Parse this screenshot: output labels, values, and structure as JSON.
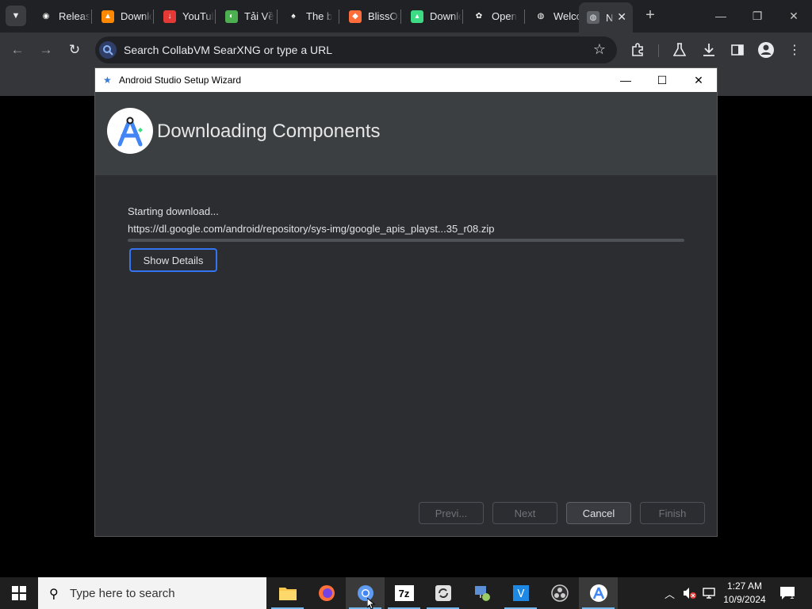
{
  "browser": {
    "tabs": [
      {
        "label": "Releases",
        "icon": "github-icon",
        "color": "#202124",
        "glyph": "◉"
      },
      {
        "label": "Download",
        "icon": "vlc-icon",
        "color": "#ff8800",
        "glyph": "▲"
      },
      {
        "label": "YouTube",
        "icon": "youtube-download-icon",
        "color": "#e53935",
        "glyph": "↓"
      },
      {
        "label": "Tải Về",
        "icon": "colorful-globe-icon",
        "color": "#4caf50",
        "glyph": "◐"
      },
      {
        "label": "The b",
        "icon": "hat-icon",
        "color": "#202124",
        "glyph": "♠"
      },
      {
        "label": "BlissOS",
        "icon": "bliss-icon",
        "color": "#ff6d3a",
        "glyph": "◆"
      },
      {
        "label": "Download",
        "icon": "android-icon",
        "color": "#3ddc84",
        "glyph": "▴"
      },
      {
        "label": "Open",
        "icon": "openai-icon",
        "color": "#202124",
        "glyph": "✿"
      },
      {
        "label": "Welcome",
        "icon": "globe-icon",
        "color": "#202124",
        "glyph": "◍"
      }
    ],
    "active_tab": {
      "label": "N",
      "icon": "globe-icon",
      "glyph": "◍"
    },
    "omnibox_text": "Search CollabVM SearXNG or type a URL"
  },
  "wizard": {
    "title": "Android Studio Setup Wizard",
    "heading": "Downloading Components",
    "status": "Starting download...",
    "url": "https://dl.google.com/android/repository/sys-img/google_apis_playst...35_r08.zip",
    "progress": 0,
    "show_details": "Show Details",
    "buttons": {
      "previous": "Previ...",
      "next": "Next",
      "cancel": "Cancel",
      "finish": "Finish"
    }
  },
  "taskbar": {
    "search_placeholder": "Type here to search",
    "time": "1:27 AM",
    "date": "10/9/2024",
    "notification_count": "1",
    "seven_zip_label": "7z"
  },
  "colors": {
    "accent": "#3574f0",
    "wizard_bg": "#2b2d30",
    "header_bg": "#3c3f41"
  }
}
